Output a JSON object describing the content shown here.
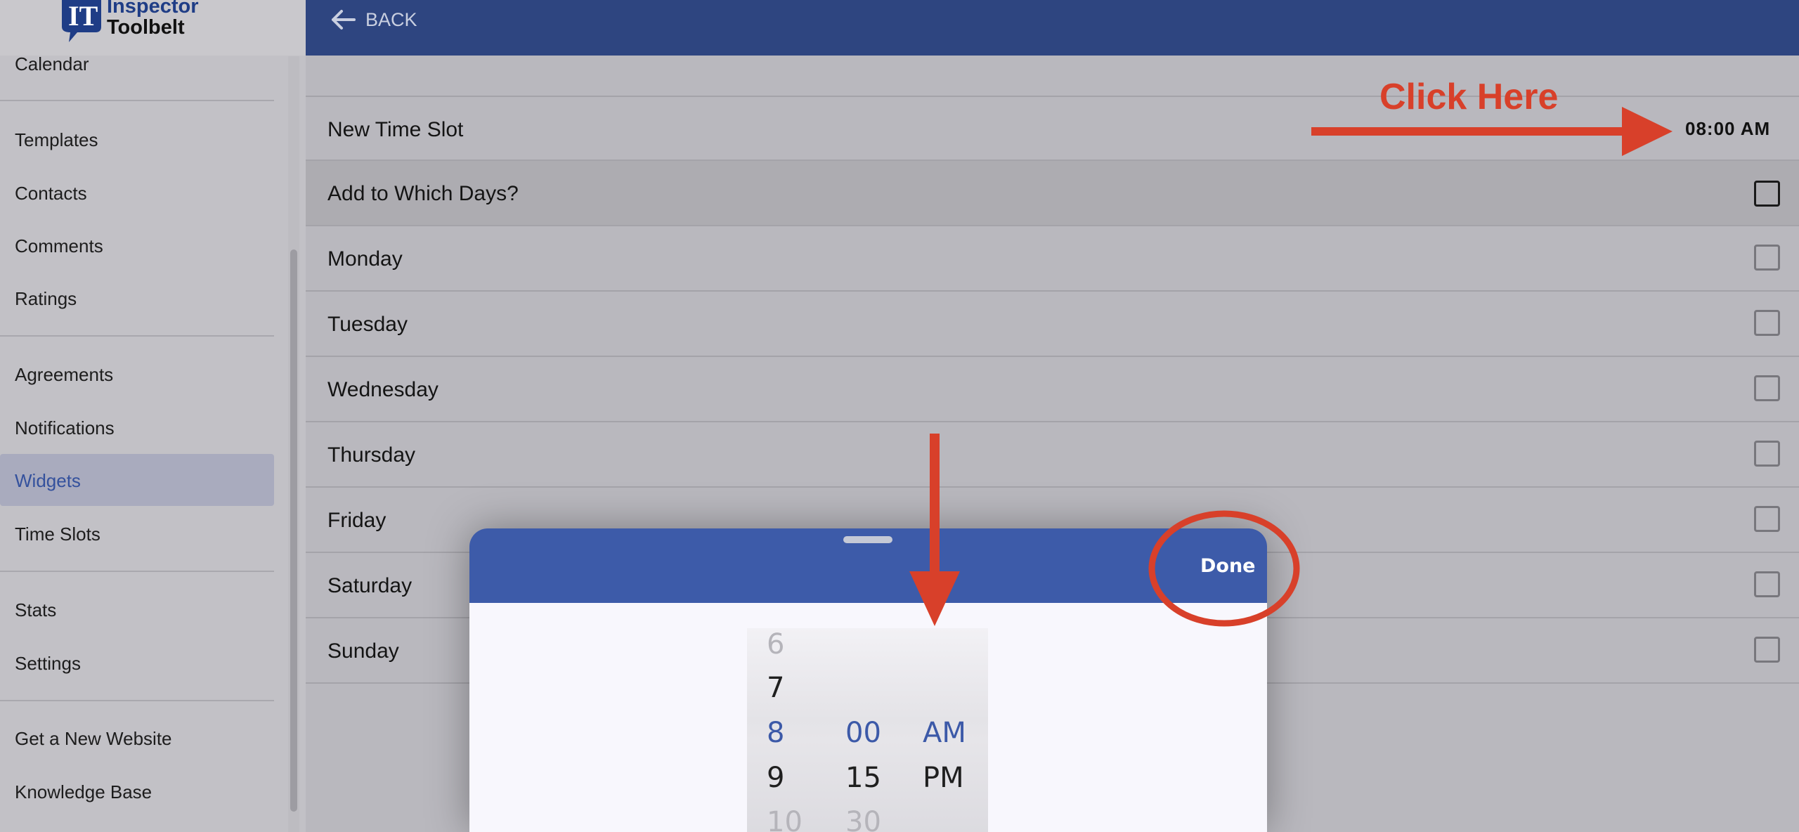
{
  "header": {
    "back_label": "BACK"
  },
  "logo": {
    "line1": "Inspector",
    "line2": "Toolbelt",
    "mark": "IT"
  },
  "sidebar": {
    "items": [
      {
        "label": "Calendar"
      },
      {
        "label": "Templates"
      },
      {
        "label": "Contacts"
      },
      {
        "label": "Comments"
      },
      {
        "label": "Ratings"
      },
      {
        "label": "Agreements"
      },
      {
        "label": "Notifications"
      },
      {
        "label": "Widgets",
        "active": true
      },
      {
        "label": "Time Slots"
      },
      {
        "label": "Stats"
      },
      {
        "label": "Settings"
      },
      {
        "label": "Get a New Website"
      },
      {
        "label": "Knowledge Base"
      }
    ]
  },
  "form": {
    "time_slot_label": "New Time Slot",
    "time_slot_value": "08:00 AM",
    "days_header": "Add to Which Days?",
    "days": [
      "Monday",
      "Tuesday",
      "Wednesday",
      "Thursday",
      "Friday",
      "Saturday",
      "Sunday"
    ]
  },
  "annotation": {
    "click_here": "Click Here"
  },
  "picker": {
    "done_label": "Done",
    "hours": [
      "6",
      "7",
      "8",
      "9",
      "10"
    ],
    "minutes": [
      "00",
      "15",
      "30"
    ],
    "periods": [
      "AM",
      "PM"
    ],
    "selected": {
      "hour": "8",
      "minute": "00",
      "period": "AM"
    }
  },
  "colors": {
    "header": "#2e4580",
    "accent": "#3d5ba9",
    "annotation": "#d8402a",
    "active_text": "#34519d"
  }
}
